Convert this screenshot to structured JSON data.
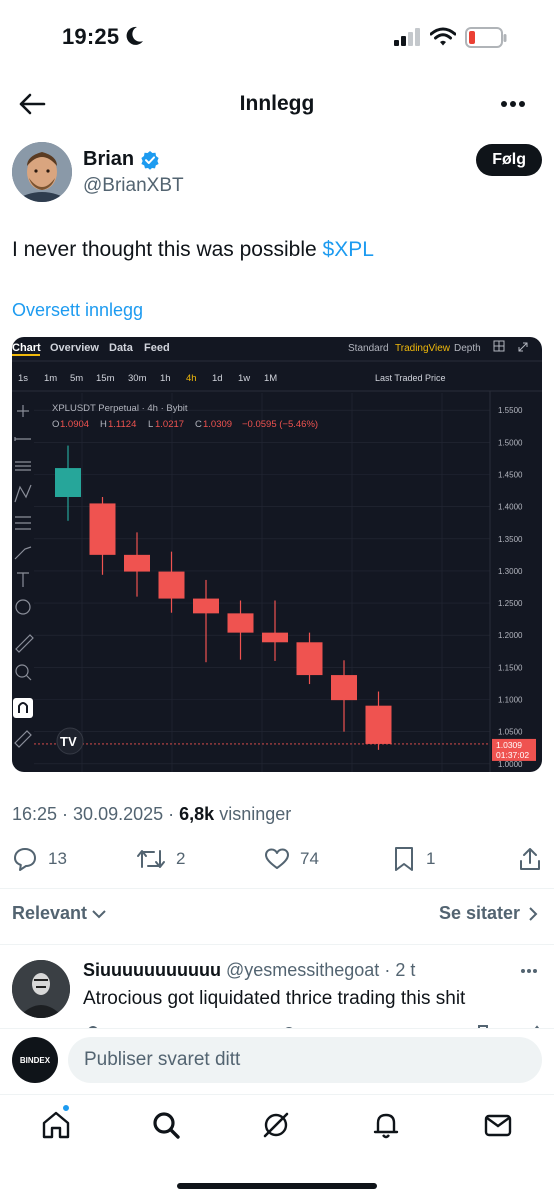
{
  "status_bar": {
    "time": "19:25"
  },
  "nav": {
    "title": "Innlegg"
  },
  "author": {
    "name": "Brian",
    "handle": "@BrianXBT",
    "follow_label": "Følg"
  },
  "tweet": {
    "text": "I never thought this was possible ",
    "cashtag": "$XPL",
    "translate_label": "Oversett innlegg",
    "time": "16:25",
    "date": "30.09.2025",
    "views_count": "6,8k",
    "views_label": "visninger"
  },
  "actions": {
    "replies": "13",
    "reposts": "2",
    "likes": "74",
    "bookmarks": "1"
  },
  "sorting": {
    "label": "Relevant",
    "quotes_label": "Se sitater"
  },
  "reply": {
    "name": "Siuuuuuuuuuuu",
    "handle": "@yesmessithegoat",
    "age": "2 t",
    "text": "Atrocious got liquidated thrice trading this shit"
  },
  "compose": {
    "placeholder": "Publiser svaret ditt",
    "avatar_label": "BINDEX"
  },
  "chart_data": {
    "type": "candlestick",
    "top_tabs": [
      "Chart",
      "Overview",
      "Data",
      "Feed"
    ],
    "top_right": [
      "Standard",
      "TradingView",
      "Depth"
    ],
    "intervals": [
      "1s",
      "1m",
      "5m",
      "15m",
      "30m",
      "1h",
      "4h",
      "1d",
      "1w",
      "1M"
    ],
    "active_interval": "4h",
    "price_source": "Last Traded Price",
    "symbol_line": "XPLUSDT Perpetual · 4h · Bybit",
    "ohlc": {
      "O": "1.0904",
      "H": "1.1124",
      "L": "1.0217",
      "C": "1.0309",
      "change": "−0.0595 (−5.46%)"
    },
    "y_ticks": [
      "1.5500",
      "1.5000",
      "1.4500",
      "1.4000",
      "1.3500",
      "1.3000",
      "1.2500",
      "1.2000",
      "1.1500",
      "1.1000",
      "1.0500",
      "1.0000"
    ],
    "ylim": [
      0.995,
      1.555
    ],
    "last_price_label": "1.0309",
    "countdown": "01:37:02",
    "candles": [
      {
        "open": 1.415,
        "high": 1.495,
        "low": 1.378,
        "close": 1.46
      },
      {
        "open": 1.405,
        "high": 1.415,
        "low": 1.294,
        "close": 1.325
      },
      {
        "open": 1.325,
        "high": 1.36,
        "low": 1.26,
        "close": 1.299
      },
      {
        "open": 1.299,
        "high": 1.33,
        "low": 1.235,
        "close": 1.257
      },
      {
        "open": 1.257,
        "high": 1.286,
        "low": 1.158,
        "close": 1.234
      },
      {
        "open": 1.234,
        "high": 1.254,
        "low": 1.162,
        "close": 1.204
      },
      {
        "open": 1.204,
        "high": 1.254,
        "low": 1.16,
        "close": 1.189
      },
      {
        "open": 1.189,
        "high": 1.204,
        "low": 1.124,
        "close": 1.138
      },
      {
        "open": 1.138,
        "high": 1.161,
        "low": 1.05,
        "close": 1.099
      },
      {
        "open": 1.0904,
        "high": 1.1124,
        "low": 1.0217,
        "close": 1.0309
      }
    ],
    "colors": {
      "down": "#ef5350",
      "bg": "#131722",
      "grid": "#242836",
      "text": "#b2b5be",
      "accent": "#f0b90b"
    }
  }
}
